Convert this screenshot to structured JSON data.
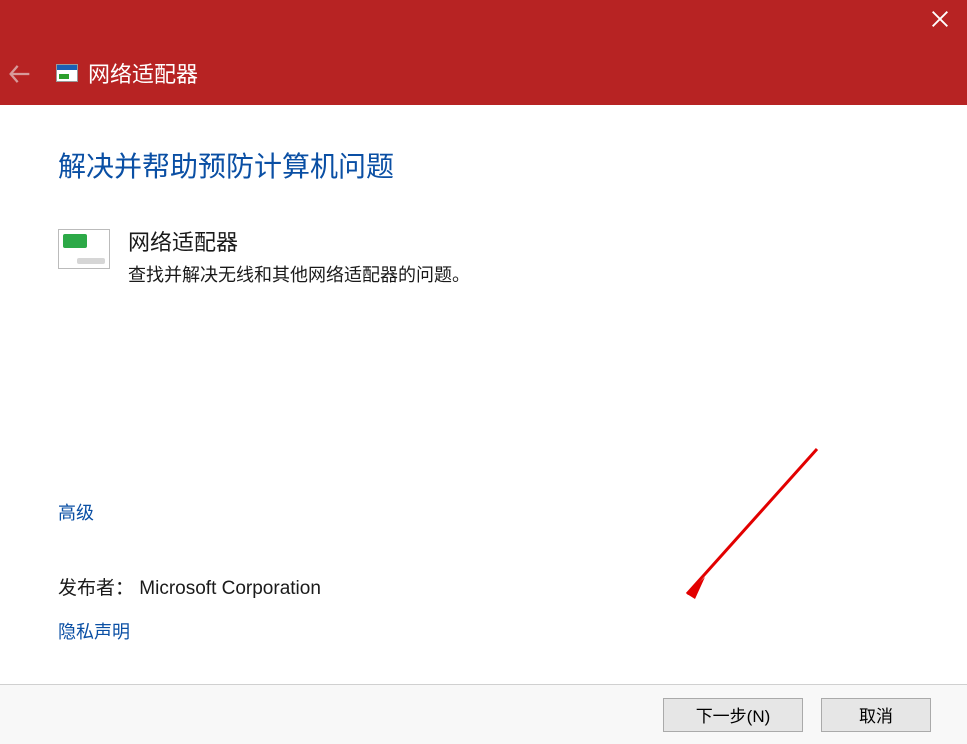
{
  "header": {
    "title": "网络适配器"
  },
  "main": {
    "heading": "解决并帮助预防计算机问题",
    "item_title": "网络适配器",
    "item_desc": "查找并解决无线和其他网络适配器的问题。"
  },
  "links": {
    "advanced": "高级",
    "publisher_label": "发布者：  Microsoft Corporation",
    "privacy": "隐私声明"
  },
  "footer": {
    "next_label": "下一步(N)",
    "cancel_label": "取消"
  }
}
